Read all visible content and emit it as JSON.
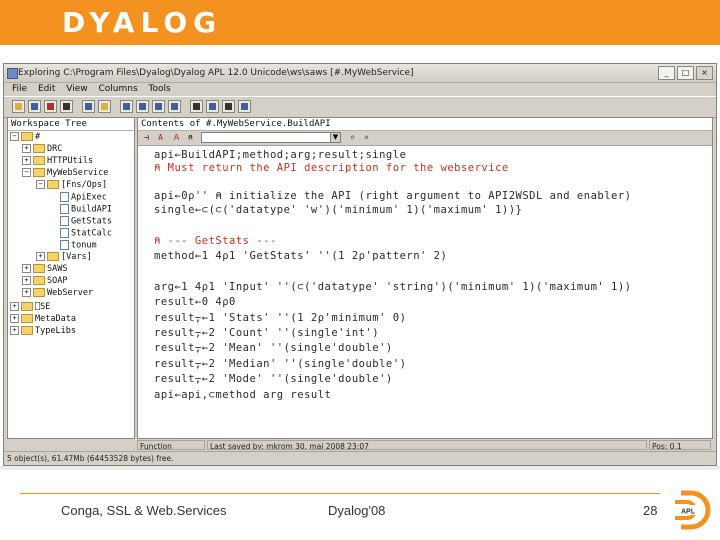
{
  "brand": {
    "logo_text": "DYALOG",
    "accent_color": "#f39221"
  },
  "window": {
    "title": "Exploring C:\\Program Files\\Dyalog\\Dyalog APL 12.0 Unicode\\ws\\saws [#.MyWebService]",
    "buttons": {
      "minimize": "_",
      "maximize": "□",
      "close": "×"
    }
  },
  "menu": [
    "File",
    "Edit",
    "View",
    "Columns",
    "Tools"
  ],
  "tree": {
    "header": "Workspace Tree",
    "nodes": [
      {
        "label": "#",
        "indent": 0,
        "expander": "−",
        "kind": "folder"
      },
      {
        "label": "DRC",
        "indent": 1,
        "expander": "+",
        "kind": "folder"
      },
      {
        "label": "HTTPUtils",
        "indent": 1,
        "expander": "+",
        "kind": "folder"
      },
      {
        "label": "MyWebService",
        "indent": 1,
        "expander": "−",
        "kind": "folder"
      },
      {
        "label": "[Fns/Ops]",
        "indent": 2,
        "expander": "−",
        "kind": "folder"
      },
      {
        "label": "ApiExec",
        "indent": 3,
        "expander": "",
        "kind": "fn"
      },
      {
        "label": "BuildAPI",
        "indent": 3,
        "expander": "",
        "kind": "fn"
      },
      {
        "label": "GetStats",
        "indent": 3,
        "expander": "",
        "kind": "fn"
      },
      {
        "label": "StatCalc",
        "indent": 3,
        "expander": "",
        "kind": "fn"
      },
      {
        "label": "tonum",
        "indent": 3,
        "expander": "",
        "kind": "fn"
      },
      {
        "label": "[Vars]",
        "indent": 2,
        "expander": "+",
        "kind": "folder"
      },
      {
        "label": "SAWS",
        "indent": 1,
        "expander": "+",
        "kind": "folder"
      },
      {
        "label": "SOAP",
        "indent": 1,
        "expander": "+",
        "kind": "folder"
      },
      {
        "label": "WebServer",
        "indent": 1,
        "expander": "+",
        "kind": "folder"
      },
      {
        "label": "⎕SE",
        "indent": 0,
        "expander": "+",
        "kind": "folder"
      },
      {
        "label": "MetaData",
        "indent": 0,
        "expander": "+",
        "kind": "folder"
      },
      {
        "label": "TypeLibs",
        "indent": 0,
        "expander": "+",
        "kind": "folder"
      }
    ]
  },
  "contents_header": "Contents of #.MyWebService.BuildAPI",
  "editor_buttons": [
    "⊣",
    "A",
    "Ａ",
    "⍝"
  ],
  "code": [
    {
      "text": "api←BuildAPI;method;arg;result;single",
      "comment": false
    },
    {
      "text": "⍝ Must return the API description for the webservice",
      "comment": true
    },
    {
      "text": "",
      "comment": false
    },
    {
      "text": "api←0⍴'' ⍝ initialize the API (right argument to API2WSDL and enabler)",
      "comment": false
    },
    {
      "text": "single←⊂(⊂('datatype' 'w')('minimum' 1)('maximum' 1))}",
      "comment": false
    },
    {
      "text": "",
      "comment": false
    },
    {
      "text": "⍝ --- GetStats ---",
      "comment": true
    },
    {
      "text": "method←1 4⍴1 'GetStats' ''(1 2⍴'pattern' 2)",
      "comment": false
    },
    {
      "text": "",
      "comment": false
    },
    {
      "text": "arg←1 4⍴1 'Input' ''(⊂('datatype' 'string')('minimum' 1)('maximum' 1))",
      "comment": false
    },
    {
      "text": "result←0 4⍴0",
      "comment": false
    },
    {
      "text": "result⍪←1 'Stats' ''(1 2⍴'minimum' 0)",
      "comment": false
    },
    {
      "text": "result⍪←2 'Count' ''(single'int')",
      "comment": false
    },
    {
      "text": "result⍪←2 'Mean' ''(single'double')",
      "comment": false
    },
    {
      "text": "result⍪←2 'Median' ''(single'double')",
      "comment": false
    },
    {
      "text": "result⍪←2 'Mode' ''(single'double')",
      "comment": false
    },
    {
      "text": "api←api,⊂method arg result",
      "comment": false
    }
  ],
  "status": {
    "type": "Function",
    "saved": "Last saved by: mkrom 30. maj 2008 23:07",
    "pos": "Pos: 0,1"
  },
  "bottom_status": "5 object(s), 61.47Mb (64453528 bytes) free.",
  "footer": {
    "left": "Conga, SSL & Web.Services",
    "center": "Dyalog'08",
    "page": "28",
    "badge": "APL"
  }
}
